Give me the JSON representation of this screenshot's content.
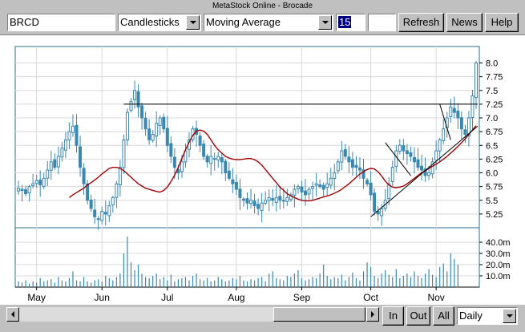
{
  "window": {
    "title": "MetaStock Online - Brocade"
  },
  "toolbar": {
    "symbol": "BRCD",
    "chart_style": "Candlesticks",
    "indicator": "Moving Average",
    "period": "15",
    "extra_value": "",
    "refresh_label": "Refresh",
    "news_label": "News",
    "help_label": "Help"
  },
  "footer": {
    "zoom_in_label": "In",
    "zoom_out_label": "Out",
    "all_label": "All",
    "interval": "Daily"
  },
  "colors": {
    "price": "#3a88b0",
    "moving_average": "#a00000",
    "grid": "#d8d8d8",
    "trendline": "#000000"
  },
  "chart_data": {
    "type": "candlestick",
    "symbol": "BRCD",
    "price_axis": {
      "ticks": [
        "8.0",
        "7.75",
        "7.5",
        "7.25",
        "7.0",
        "6.75",
        "6.5",
        "6.25",
        "6.0",
        "5.75",
        "5.5",
        "5.25"
      ],
      "ylim": [
        5.0,
        8.3
      ]
    },
    "volume_axis": {
      "ticks": [
        "40.0m",
        "30.0m",
        "20.0m",
        "10.0m"
      ],
      "ylim": [
        0,
        50
      ]
    },
    "x_labels": [
      "May",
      "Jun",
      "Jul",
      "Aug",
      "Sep",
      "Oct",
      "Nov"
    ],
    "moving_average_period": 15,
    "grid": true,
    "horizontal_line": 7.25,
    "close": [
      5.72,
      5.68,
      5.62,
      5.75,
      5.8,
      5.86,
      5.78,
      5.9,
      6.05,
      6.2,
      6.1,
      6.3,
      6.45,
      6.6,
      6.75,
      6.85,
      6.5,
      6.1,
      5.8,
      5.5,
      5.35,
      5.2,
      5.15,
      5.3,
      5.25,
      5.4,
      5.55,
      5.8,
      6.1,
      6.6,
      7.1,
      7.3,
      7.5,
      7.2,
      7.0,
      6.8,
      6.6,
      6.7,
      6.9,
      7.0,
      6.8,
      6.5,
      6.3,
      6.1,
      6.0,
      6.2,
      6.4,
      6.6,
      6.8,
      6.7,
      6.5,
      6.3,
      6.2,
      6.3,
      6.25,
      6.3,
      6.2,
      6.0,
      5.9,
      5.8,
      5.7,
      5.55,
      5.5,
      5.45,
      5.5,
      5.4,
      5.35,
      5.45,
      5.5,
      5.55,
      5.5,
      5.55,
      5.5,
      5.5,
      5.55,
      5.6,
      5.7,
      5.75,
      5.65,
      5.6,
      5.7,
      5.75,
      5.8,
      5.75,
      5.7,
      5.8,
      5.9,
      6.0,
      6.2,
      6.4,
      6.3,
      6.2,
      6.1,
      6.1,
      6.05,
      5.9,
      5.8,
      5.6,
      5.3,
      5.25,
      5.35,
      5.5,
      5.8,
      6.1,
      6.4,
      6.5,
      6.4,
      6.35,
      6.3,
      6.2,
      6.1,
      6.05,
      5.95,
      6.0,
      6.2,
      6.4,
      6.6,
      6.8,
      7.0,
      7.2,
      7.1,
      7.0,
      6.8,
      6.7,
      7.0,
      7.4,
      8.0
    ],
    "moving_average": [
      5.55,
      5.6,
      5.64,
      5.68,
      5.72,
      5.78,
      5.82,
      5.87,
      5.92,
      5.98,
      6.03,
      6.08,
      6.1,
      6.1,
      6.08,
      6.04,
      5.98,
      5.92,
      5.86,
      5.8,
      5.76,
      5.72,
      5.7,
      5.68,
      5.66,
      5.65,
      5.68,
      5.74,
      5.84,
      5.96,
      6.1,
      6.26,
      6.42,
      6.56,
      6.68,
      6.76,
      6.78,
      6.76,
      6.7,
      6.6,
      6.5,
      6.42,
      6.36,
      6.3,
      6.27,
      6.25,
      6.24,
      6.24,
      6.25,
      6.26,
      6.26,
      6.24,
      6.2,
      6.14,
      6.06,
      5.98,
      5.9,
      5.82,
      5.74,
      5.68,
      5.62,
      5.58,
      5.55,
      5.52,
      5.5,
      5.49,
      5.49,
      5.5,
      5.52,
      5.54,
      5.56,
      5.58,
      5.6,
      5.63,
      5.66,
      5.7,
      5.75,
      5.8,
      5.86,
      5.92,
      5.98,
      6.02,
      6.06,
      6.08,
      6.07,
      6.02,
      5.94,
      5.85,
      5.78,
      5.74,
      5.73,
      5.74,
      5.76,
      5.8,
      5.85,
      5.9,
      5.95,
      6.0,
      6.04,
      6.08,
      6.12,
      6.16,
      6.2,
      6.25,
      6.3,
      6.36,
      6.42,
      6.48,
      6.55,
      6.62,
      6.7,
      6.78,
      6.86
    ],
    "volume": [
      5,
      4,
      6,
      3,
      5,
      4,
      8,
      5,
      6,
      7,
      4,
      9,
      6,
      5,
      8,
      14,
      6,
      5,
      9,
      5,
      4,
      6,
      7,
      5,
      10,
      8,
      6,
      9,
      12,
      30,
      45,
      22,
      15,
      20,
      12,
      9,
      8,
      10,
      12,
      7,
      9,
      6,
      11,
      5,
      7,
      8,
      9,
      6,
      10,
      12,
      7,
      6,
      8,
      5,
      6,
      9,
      7,
      5,
      6,
      8,
      7,
      10,
      6,
      5,
      7,
      6,
      8,
      9,
      5,
      12,
      14,
      8,
      7,
      6,
      10,
      9,
      12,
      15,
      8,
      6,
      7,
      9,
      8,
      12,
      20,
      10,
      7,
      9,
      8,
      11,
      6,
      9,
      13,
      8,
      6,
      14,
      22,
      18,
      10,
      8,
      12,
      15,
      11,
      9,
      16,
      8,
      10,
      12,
      9,
      14,
      10,
      8,
      12,
      16,
      11,
      9,
      18,
      21,
      14,
      30,
      25,
      20
    ]
  }
}
